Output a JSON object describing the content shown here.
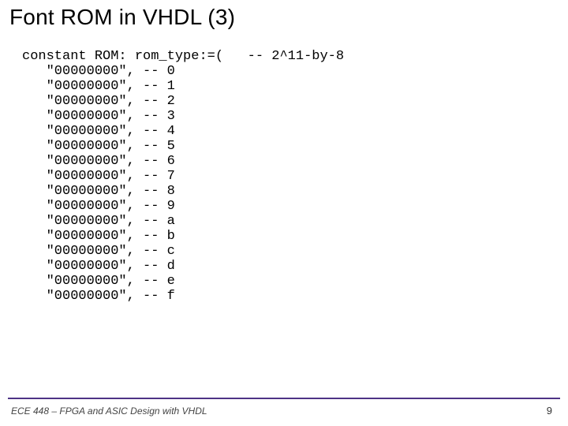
{
  "title": "Font ROM in VHDL (3)",
  "code": {
    "decl": "constant ROM:",
    "decl_right": "rom_type:=(",
    "decl_comment": "-- 2^11-by-8",
    "rows": [
      {
        "val": "\"00000000\",",
        "sep": "--",
        "idx": "0"
      },
      {
        "val": "\"00000000\",",
        "sep": "--",
        "idx": "1"
      },
      {
        "val": "\"00000000\",",
        "sep": "--",
        "idx": "2"
      },
      {
        "val": "\"00000000\",",
        "sep": "--",
        "idx": "3"
      },
      {
        "val": "\"00000000\",",
        "sep": "--",
        "idx": "4"
      },
      {
        "val": "\"00000000\",",
        "sep": "--",
        "idx": "5"
      },
      {
        "val": "\"00000000\",",
        "sep": "--",
        "idx": "6"
      },
      {
        "val": "\"00000000\",",
        "sep": "--",
        "idx": "7"
      },
      {
        "val": "\"00000000\",",
        "sep": "--",
        "idx": "8"
      },
      {
        "val": "\"00000000\",",
        "sep": "--",
        "idx": "9"
      },
      {
        "val": "\"00000000\",",
        "sep": "--",
        "idx": "a"
      },
      {
        "val": "\"00000000\",",
        "sep": "--",
        "idx": "b"
      },
      {
        "val": "\"00000000\",",
        "sep": "--",
        "idx": "c"
      },
      {
        "val": "\"00000000\",",
        "sep": "--",
        "idx": "d"
      },
      {
        "val": "\"00000000\",",
        "sep": "--",
        "idx": "e"
      },
      {
        "val": "\"00000000\",",
        "sep": "--",
        "idx": "f"
      }
    ]
  },
  "footer": "ECE 448 – FPGA and ASIC Design with VHDL",
  "page": "9"
}
